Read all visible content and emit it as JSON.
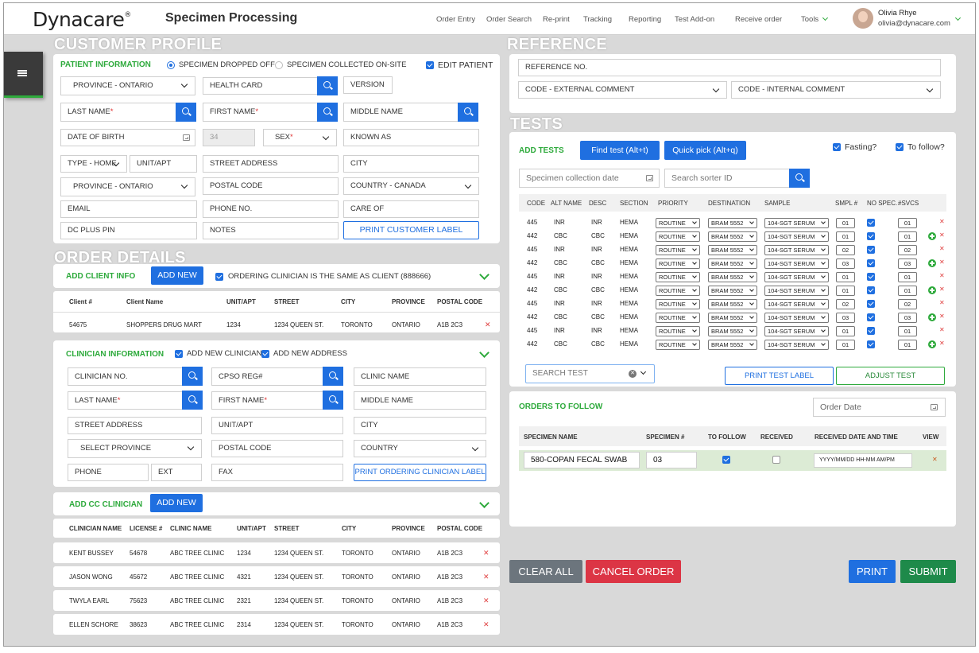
{
  "app": {
    "logo": "Dynacare",
    "title": "Specimen Processing"
  },
  "nav": [
    "Order Entry",
    "Order Search",
    "Re-print",
    "Tracking",
    "Reporting",
    "Test Add-on",
    "Receive order",
    "Tools"
  ],
  "user": {
    "name": "Olivia Rhye",
    "email": "olivia@dynacare.com"
  },
  "sections": {
    "customer_profile": "CUSTOMER PROFILE",
    "order_details": "ORDER DETAILS",
    "reference": "REFERENCE",
    "tests": "TESTS"
  },
  "patient": {
    "title": "PATIENT INFORMATION",
    "radio_dropped": "SPECIMEN DROPPED OFF",
    "radio_collected": "SPECIMEN COLLECTED ON-SITE",
    "edit_patient": "EDIT PATIENT",
    "province": "PROVINCE - ONTARIO",
    "health_card": "HEALTH CARD",
    "version": "VERSION",
    "last_name": "LAST NAME",
    "first_name": "FIRST NAME",
    "middle_name": "MIDDLE NAME",
    "dob": "DATE OF BIRTH",
    "age": "34",
    "sex": "SEX",
    "known_as": "KNOWN AS",
    "type": "TYPE - HOME",
    "unit": "UNIT/APT",
    "street": "STREET ADDRESS",
    "city": "CITY",
    "province2": "PROVINCE - ONTARIO",
    "postal": "POSTAL CODE",
    "country": "COUNTRY - CANADA",
    "email": "EMAIL",
    "phone": "PHONE NO.",
    "care_of": "CARE OF",
    "dc_plus": "DC PLUS PIN",
    "notes": "NOTES",
    "print_label": "PRINT CUSTOMER LABEL"
  },
  "client": {
    "title": "ADD CLIENT INFO",
    "add_new": "ADD NEW",
    "same_as": "ORDERING CLINICIAN IS THE SAME AS CLIENT (888666)",
    "headers": [
      "Client #",
      "Client Name",
      "UNIT/APT",
      "STREET",
      "CITY",
      "PROVINCE",
      "POSTAL CODE"
    ],
    "rows": [
      [
        "54675",
        "SHOPPERS DRUG MART",
        "1234",
        "1234 QUEEN ST.",
        "TORONTO",
        "ONTARIO",
        "A1B 2C3"
      ]
    ]
  },
  "clinician": {
    "title": "CLINICIAN INFORMATION",
    "add_new_clinician": "ADD NEW CLINICIAN",
    "add_new_address": "ADD NEW ADDRESS",
    "clinician_no": "CLINICIAN NO.",
    "cpso": "CPSO REG#",
    "clinic_name": "CLINIC NAME",
    "last_name": "LAST NAME",
    "first_name": "FIRST NAME",
    "middle_name": "MIDDLE NAME",
    "street": "STREET ADDRESS",
    "unit": "UNIT/APT",
    "city": "CITY",
    "province": "SELECT PROVINCE",
    "postal": "POSTAL CODE",
    "country": "COUNTRY",
    "phone": "PHONE",
    "ext": "EXT",
    "fax": "FAX",
    "print_label": "PRINT ORDERING CLINICIAN LABEL"
  },
  "cc": {
    "title": "ADD CC CLINICIAN",
    "add_new": "ADD NEW",
    "headers": [
      "CLINICIAN NAME",
      "LICENSE #",
      "CLINIC NAME",
      "UNIT/APT",
      "STREET",
      "CITY",
      "PROVINCE",
      "POSTAL CODE"
    ],
    "rows": [
      [
        "KENT BUSSEY",
        "54678",
        "ABC TREE CLINIC",
        "1234",
        "1234 QUEEN ST.",
        "TORONTO",
        "ONTARIO",
        "A1B 2C3"
      ],
      [
        "JASON WONG",
        "45672",
        "ABC TREE CLINIC",
        "4321",
        "1234 QUEEN ST.",
        "TORONTO",
        "ONTARIO",
        "A1B 2C3"
      ],
      [
        "TWYLA EARL",
        "75623",
        "ABC TREE CLINIC",
        "2321",
        "1234 QUEEN ST.",
        "TORONTO",
        "ONTARIO",
        "A1B 2C3"
      ],
      [
        "ELLEN SCHORE",
        "38623",
        "ABC TREE CLINIC",
        "2314",
        "1234 QUEEN ST.",
        "TORONTO",
        "ONTARIO",
        "A1B 2C3"
      ]
    ]
  },
  "reference": {
    "ref_no": "REFERENCE NO.",
    "external": "CODE - EXTERNAL COMMENT",
    "internal": "CODE - INTERNAL COMMENT"
  },
  "tests": {
    "title": "ADD TESTS",
    "find": "Find test (Alt+t)",
    "quick": "Quick pick (Alt+q)",
    "fasting": "Fasting?",
    "to_follow": "To follow?",
    "collection_date": "Specimen collection date",
    "sorter": "Search sorter ID",
    "headers": [
      "CODE",
      "ALT NAME",
      "DESC",
      "SECTION",
      "PRIORITY",
      "DESTINATION",
      "SAMPLE",
      "SMPL #",
      "NO SPEC.",
      "#SVCS"
    ],
    "rows": [
      {
        "code": "445",
        "alt": "INR",
        "desc": "INR",
        "section": "HEMA",
        "priority": "ROUTINE",
        "dest": "BRAM 5552",
        "sample": "104-SGT SERUM",
        "smpl": "01",
        "svcs": "01",
        "plus": false
      },
      {
        "code": "442",
        "alt": "CBC",
        "desc": "CBC",
        "section": "HEMA",
        "priority": "ROUTINE",
        "dest": "BRAM 5552",
        "sample": "104-SGT SERUM",
        "smpl": "01",
        "svcs": "01",
        "plus": true
      },
      {
        "code": "445",
        "alt": "INR",
        "desc": "INR",
        "section": "HEMA",
        "priority": "ROUTINE",
        "dest": "BRAM 5552",
        "sample": "104-SGT SERUM",
        "smpl": "02",
        "svcs": "02",
        "plus": false
      },
      {
        "code": "442",
        "alt": "CBC",
        "desc": "CBC",
        "section": "HEMA",
        "priority": "ROUTINE",
        "dest": "BRAM 5552",
        "sample": "104-SGT SERUM",
        "smpl": "03",
        "svcs": "03",
        "plus": true
      },
      {
        "code": "445",
        "alt": "INR",
        "desc": "INR",
        "section": "HEMA",
        "priority": "ROUTINE",
        "dest": "BRAM 5552",
        "sample": "104-SGT SERUM",
        "smpl": "01",
        "svcs": "01",
        "plus": false
      },
      {
        "code": "442",
        "alt": "CBC",
        "desc": "CBC",
        "section": "HEMA",
        "priority": "ROUTINE",
        "dest": "BRAM 5552",
        "sample": "104-SGT SERUM",
        "smpl": "01",
        "svcs": "01",
        "plus": true
      },
      {
        "code": "445",
        "alt": "INR",
        "desc": "INR",
        "section": "HEMA",
        "priority": "ROUTINE",
        "dest": "BRAM 5552",
        "sample": "104-SGT SERUM",
        "smpl": "02",
        "svcs": "02",
        "plus": false
      },
      {
        "code": "442",
        "alt": "CBC",
        "desc": "CBC",
        "section": "HEMA",
        "priority": "ROUTINE",
        "dest": "BRAM 5552",
        "sample": "104-SGT SERUM",
        "smpl": "03",
        "svcs": "03",
        "plus": true
      },
      {
        "code": "445",
        "alt": "INR",
        "desc": "INR",
        "section": "HEMA",
        "priority": "ROUTINE",
        "dest": "BRAM 5552",
        "sample": "104-SGT SERUM",
        "smpl": "01",
        "svcs": "01",
        "plus": false
      },
      {
        "code": "442",
        "alt": "CBC",
        "desc": "CBC",
        "section": "HEMA",
        "priority": "ROUTINE",
        "dest": "BRAM 5552",
        "sample": "104-SGT SERUM",
        "smpl": "01",
        "svcs": "01",
        "plus": true
      }
    ],
    "search": "SEARCH TEST",
    "print_label": "PRINT TEST LABEL",
    "adjust": "ADJUST TEST"
  },
  "follow": {
    "title": "ORDERS TO FOLLOW",
    "order_date": "Order Date",
    "headers": [
      "SPECIMEN NAME",
      "SPECIMEN #",
      "TO FOLLOW",
      "RECEIVED",
      "RECEIVED DATE AND TIME",
      "VIEW"
    ],
    "specimen_name": "580-COPAN FECAL SWAB",
    "specimen_no": "03",
    "datetime": "YYYY/MM/DD HH-MM AM/PM"
  },
  "actions": {
    "clear": "CLEAR ALL",
    "cancel": "CANCEL ORDER",
    "print": "PRINT",
    "submit": "SUBMIT"
  },
  "colors": {
    "accent_blue": "#1f6fe0",
    "green": "#2eaa3c",
    "red": "#dc3545",
    "grey_btn": "#6c757d",
    "submit": "#1e8a4a"
  }
}
